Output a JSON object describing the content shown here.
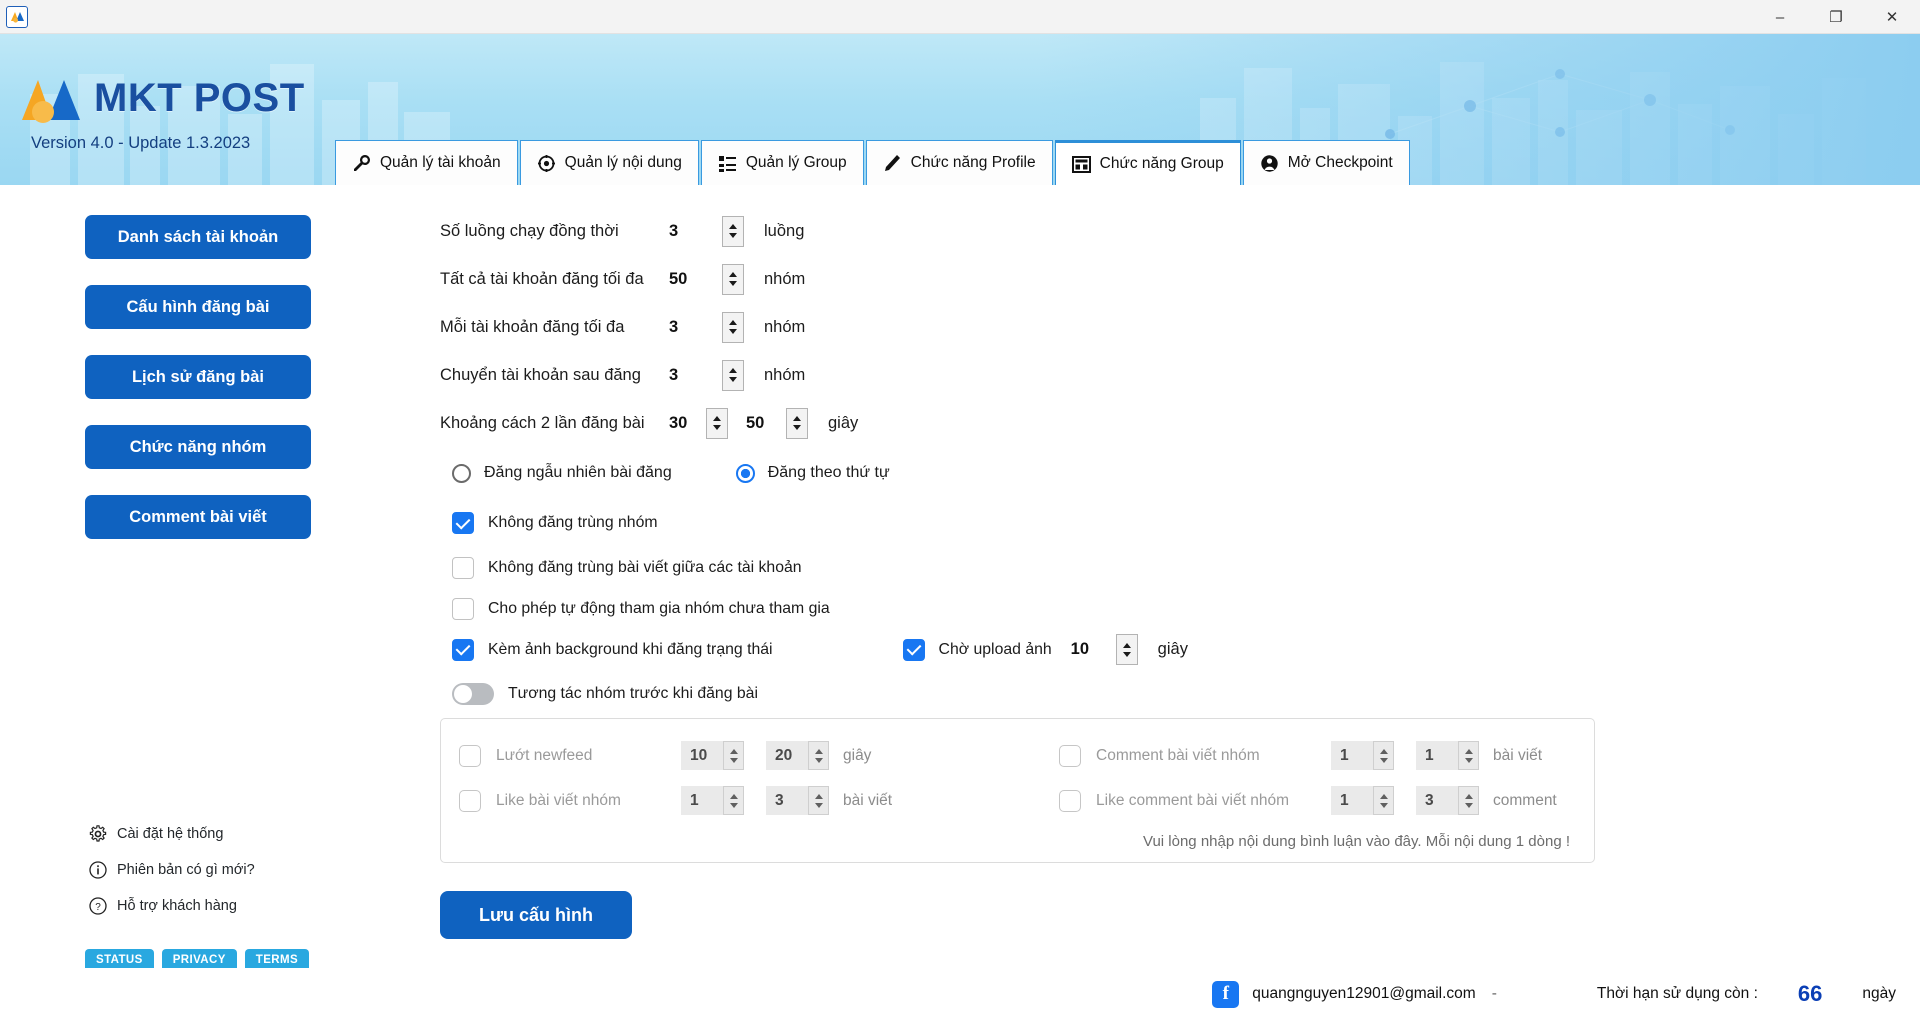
{
  "window": {
    "app_icon": "mkt-post-app-icon",
    "minimize": "–",
    "maximize": "❐",
    "close": "✕"
  },
  "header": {
    "brand": "MKT POST",
    "version": "Version 4.0 - Update 1.3.2023",
    "accent_blue": "#1a4fa0",
    "banner_bg": "#a9dff4"
  },
  "tabs": [
    {
      "label": "Quản lý tài khoản",
      "icon": "wrench-icon",
      "active": false
    },
    {
      "label": "Quản lý nội dung",
      "icon": "content-gear-icon",
      "active": false
    },
    {
      "label": "Quản lý Group",
      "icon": "list-icon",
      "active": false
    },
    {
      "label": "Chức năng Profile",
      "icon": "pen-icon",
      "active": false
    },
    {
      "label": "Chức năng Group",
      "icon": "grid-window-icon",
      "active": true
    },
    {
      "label": "Mở Checkpoint",
      "icon": "user-icon",
      "active": false
    }
  ],
  "sidebar": {
    "buttons": [
      "Danh sách tài khoản",
      "Cấu hình đăng bài",
      "Lịch sử đăng bài",
      "Chức năng nhóm",
      "Comment bài viết"
    ],
    "links": [
      {
        "label": "Cài đặt hệ thống",
        "icon": "gear-icon"
      },
      {
        "label": "Phiên bản có gì mới?",
        "icon": "info-icon"
      },
      {
        "label": "Hỗ trợ khách hàng",
        "icon": "question-icon"
      }
    ],
    "pills": [
      "STATUS",
      "PRIVACY",
      "TERMS"
    ],
    "pill_color": "#29a8e0",
    "button_color": "#0f62c0"
  },
  "form": {
    "rows": [
      {
        "label": "Số luồng chạy đồng thời",
        "value": "3",
        "unit": "luồng"
      },
      {
        "label": "Tất cả tài khoản đăng tối đa",
        "value": "50",
        "unit": "nhóm"
      },
      {
        "label": "Mỗi tài khoản đăng tối đa",
        "value": "3",
        "unit": "nhóm"
      },
      {
        "label": "Chuyển tài khoản sau đăng",
        "value": "3",
        "unit": "nhóm"
      }
    ],
    "interval_row": {
      "label": "Khoảng cách 2 lần đăng bài",
      "value_min": "30",
      "value_max": "50",
      "unit": "giây"
    },
    "radios": [
      {
        "label": "Đăng ngẫu nhiên bài đăng",
        "selected": false
      },
      {
        "label": "Đăng theo thứ tự",
        "selected": true
      }
    ],
    "checkboxes": [
      {
        "label": "Không đăng trùng nhóm",
        "checked": true
      },
      {
        "label": "Không đăng trùng bài viết giữa các tài khoản",
        "checked": false
      },
      {
        "label": "Cho phép tự động tham gia nhóm chưa tham gia",
        "checked": false
      },
      {
        "label": "Kèm ảnh background khi đăng trạng thái",
        "checked": true
      }
    ],
    "upload_wait": {
      "label": "Chờ upload ảnh",
      "checked": true,
      "value": "10",
      "unit": "giây"
    },
    "toggle": {
      "label": "Tương tác nhóm trước khi đăng bài",
      "on": false
    },
    "interaction": {
      "left": [
        {
          "label": "Lướt newfeed",
          "min": "10",
          "max": "20",
          "unit": "giây",
          "checked": false
        },
        {
          "label": "Like bài viết nhóm",
          "min": "1",
          "max": "3",
          "unit": "bài viết",
          "checked": false
        }
      ],
      "right": [
        {
          "label": "Comment bài viết nhóm",
          "min": "1",
          "max": "1",
          "unit": "bài viết",
          "checked": false
        },
        {
          "label": "Like comment bài viết nhóm",
          "min": "1",
          "max": "3",
          "unit": "comment",
          "checked": false
        }
      ],
      "hint": "Vui lòng nhập nội dung bình luận vào đây. Mỗi nội dung 1 dòng !"
    },
    "save_label": "Lưu cấu hình"
  },
  "statusbar": {
    "fb_letter": "f",
    "email": "quangnguyen12901@gmail.com",
    "separator": "-",
    "expiry_label": "Thời hạn sử dụng còn :",
    "days": "66",
    "days_unit": "ngày",
    "days_color": "#0b3fb5"
  }
}
